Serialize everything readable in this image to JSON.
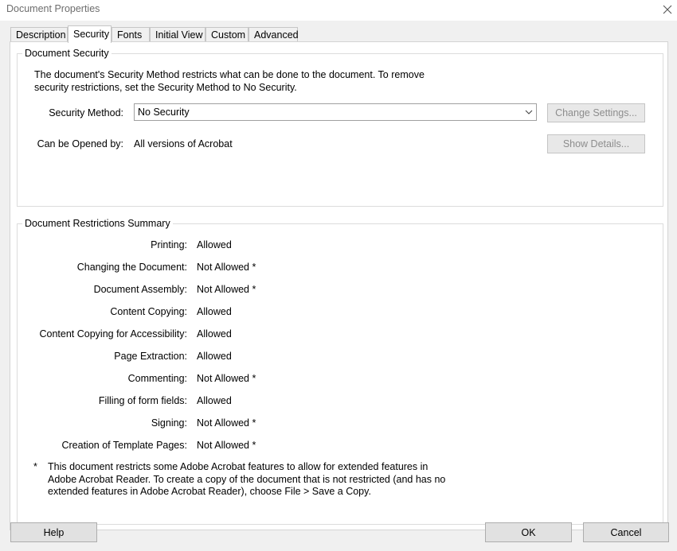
{
  "window": {
    "title": "Document Properties"
  },
  "tabs": [
    {
      "label": "Description"
    },
    {
      "label": "Security"
    },
    {
      "label": "Fonts"
    },
    {
      "label": "Initial View"
    },
    {
      "label": "Custom"
    },
    {
      "label": "Advanced"
    }
  ],
  "security": {
    "group_title": "Document Security",
    "description_line1": "The document's Security Method restricts what can be done to the document. To remove",
    "description_line2": "security restrictions, set the Security Method to No Security.",
    "method_label": "Security Method:",
    "method_value": "No Security",
    "change_settings_label": "Change Settings...",
    "opened_by_label": "Can be Opened by:",
    "opened_by_value": "All versions of Acrobat",
    "show_details_label": "Show Details..."
  },
  "restrictions": {
    "group_title": "Document Restrictions Summary",
    "rows": [
      {
        "label": "Printing:",
        "value": "Allowed"
      },
      {
        "label": "Changing the Document:",
        "value": "Not Allowed *"
      },
      {
        "label": "Document Assembly:",
        "value": "Not Allowed *"
      },
      {
        "label": "Content Copying:",
        "value": "Allowed"
      },
      {
        "label": "Content Copying for Accessibility:",
        "value": "Allowed"
      },
      {
        "label": "Page Extraction:",
        "value": "Allowed"
      },
      {
        "label": "Commenting:",
        "value": "Not Allowed *"
      },
      {
        "label": "Filling of form fields:",
        "value": "Allowed"
      },
      {
        "label": "Signing:",
        "value": "Not Allowed *"
      },
      {
        "label": "Creation of Template Pages:",
        "value": "Not Allowed *"
      }
    ],
    "footnote_marker": "*",
    "footnote_line1": "This document restricts some Adobe Acrobat features to allow for extended features in",
    "footnote_line2": "Adobe Acrobat Reader. To create a copy of the document that is not restricted (and has no",
    "footnote_line3": "extended features in Adobe Acrobat Reader), choose File > Save a Copy."
  },
  "footer": {
    "help_label": "Help",
    "ok_label": "OK",
    "cancel_label": "Cancel"
  }
}
